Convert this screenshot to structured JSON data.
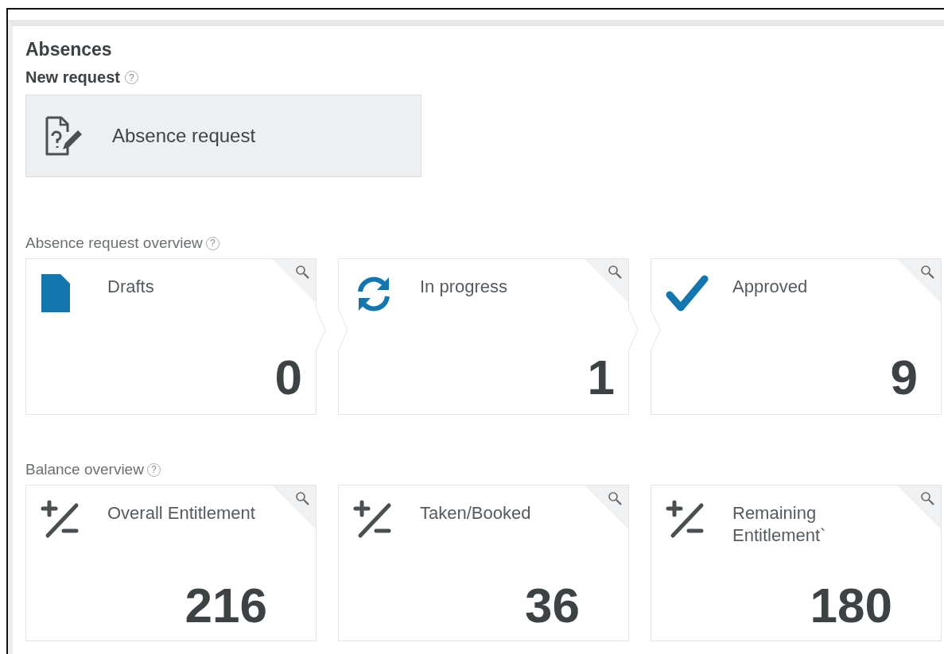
{
  "title": "Absences",
  "new_request": {
    "heading": "New request",
    "help": "?",
    "button": "Absence request"
  },
  "sections": [
    {
      "title": "Absence request overview",
      "help": "?",
      "kind": "status",
      "tiles": [
        {
          "kind": "document",
          "label": "Drafts",
          "value": "0"
        },
        {
          "kind": "sync",
          "label": "In progress",
          "value": "1"
        },
        {
          "kind": "check",
          "label": "Approved",
          "value": "9"
        }
      ]
    },
    {
      "title": "Balance overview",
      "help": "?",
      "kind": "balance",
      "tiles": [
        {
          "kind": "plus-minus",
          "label": "Overall Entitlement",
          "value": "216"
        },
        {
          "kind": "plus-minus",
          "label": "Taken/Booked",
          "value": "36"
        },
        {
          "kind": "plus-minus",
          "label": "Remaining Entitlement`",
          "value": "180"
        }
      ]
    }
  ]
}
